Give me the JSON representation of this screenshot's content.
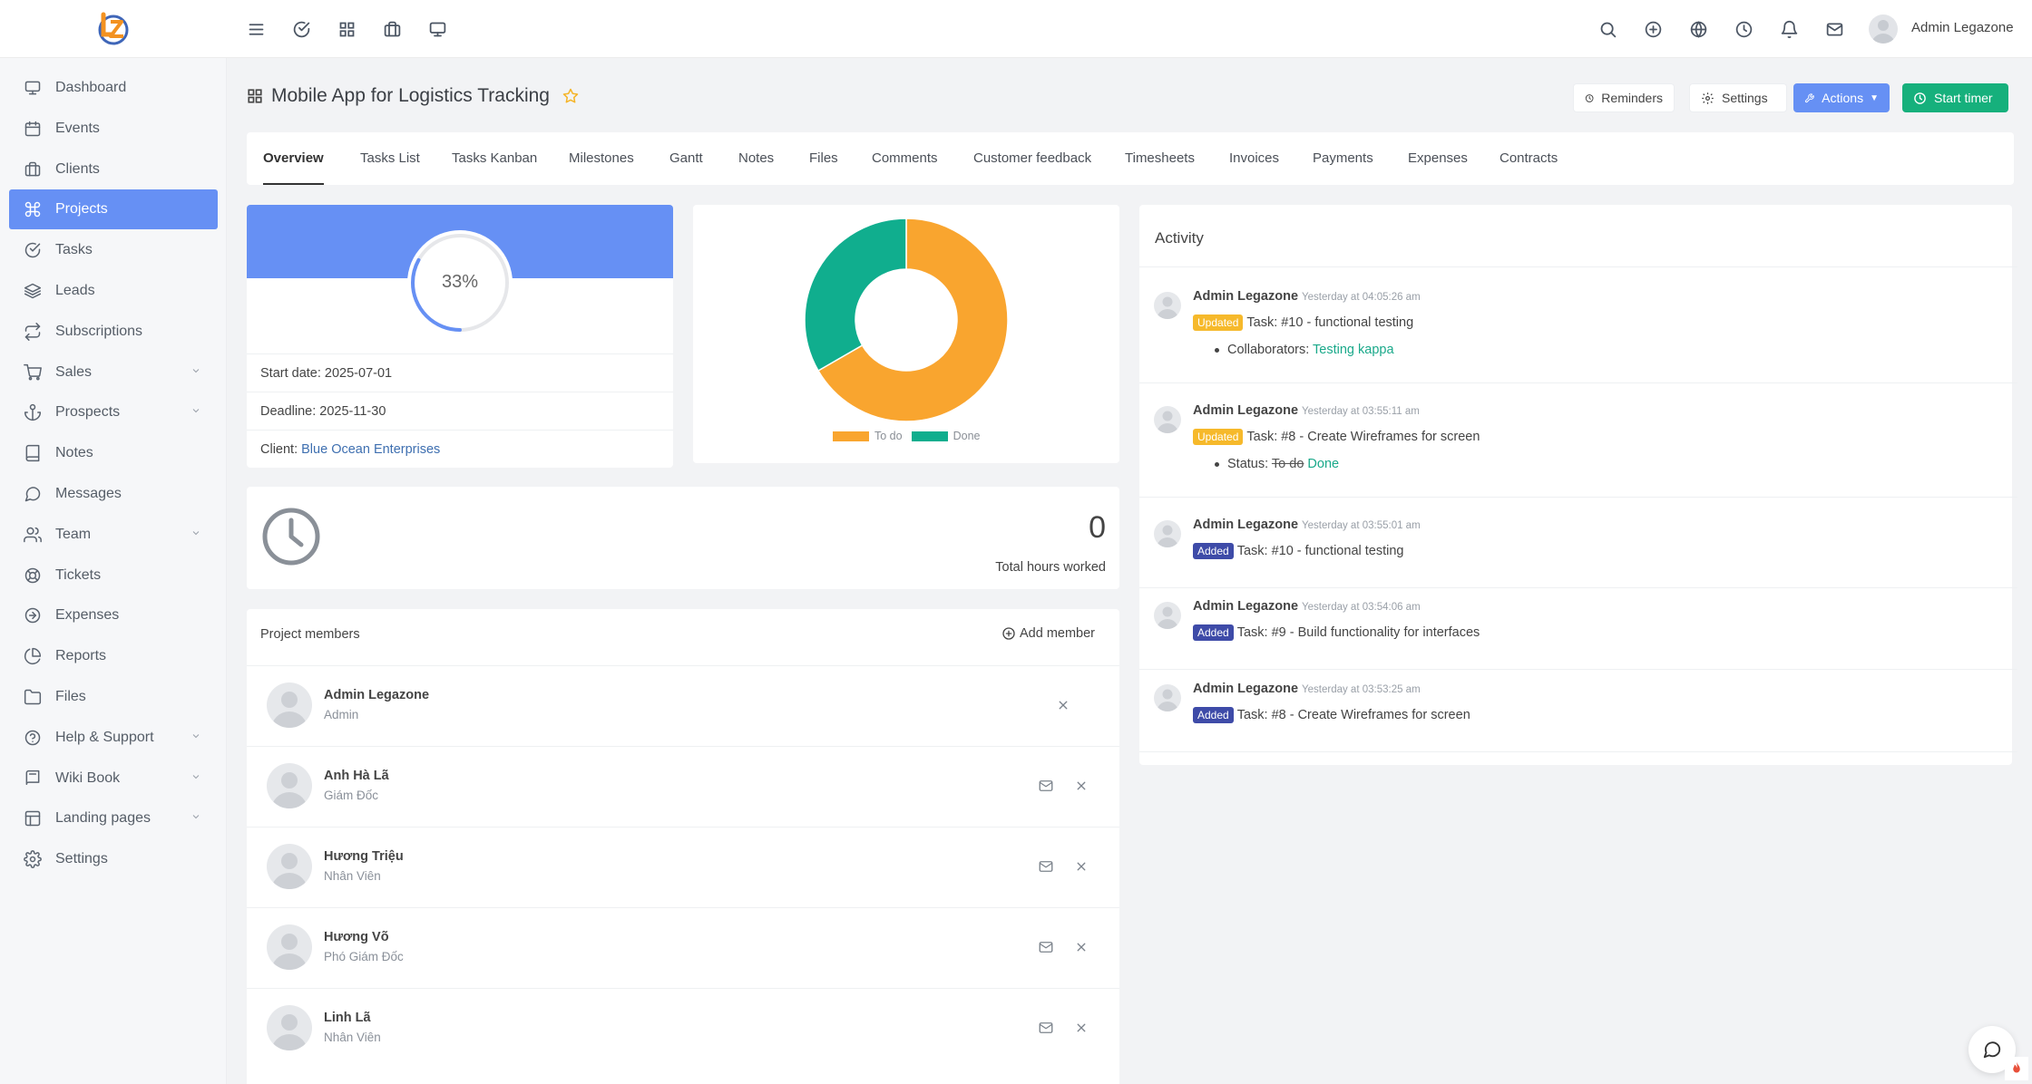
{
  "app": {
    "user_name": "Admin Legazone",
    "top_icons": [
      "menu-icon",
      "check-circle-icon",
      "apps-grid-icon",
      "briefcase-icon",
      "monitor-icon",
      "search-icon",
      "plus-circle-icon",
      "globe-icon",
      "clock-icon",
      "bell-icon",
      "mail-icon"
    ]
  },
  "sidebar": {
    "items": [
      {
        "label": "Dashboard",
        "icon": "monitor-icon"
      },
      {
        "label": "Events",
        "icon": "calendar-icon"
      },
      {
        "label": "Clients",
        "icon": "briefcase-icon"
      },
      {
        "label": "Projects",
        "icon": "command-icon",
        "active": true
      },
      {
        "label": "Tasks",
        "icon": "check-circle-icon"
      },
      {
        "label": "Leads",
        "icon": "layers-icon"
      },
      {
        "label": "Subscriptions",
        "icon": "repeat-icon"
      },
      {
        "label": "Sales",
        "icon": "cart-icon",
        "submenu": true
      },
      {
        "label": "Prospects",
        "icon": "anchor-icon",
        "submenu": true
      },
      {
        "label": "Notes",
        "icon": "book-icon"
      },
      {
        "label": "Messages",
        "icon": "message-circle-icon"
      },
      {
        "label": "Team",
        "icon": "users-icon",
        "submenu": true
      },
      {
        "label": "Tickets",
        "icon": "life-buoy-icon"
      },
      {
        "label": "Expenses",
        "icon": "arrow-right-circle-icon"
      },
      {
        "label": "Reports",
        "icon": "pie-chart-icon"
      },
      {
        "label": "Files",
        "icon": "folder-icon"
      },
      {
        "label": "Help & Support",
        "icon": "help-circle-icon",
        "submenu": true
      },
      {
        "label": "Wiki Book",
        "icon": "book-open-icon",
        "submenu": true
      },
      {
        "label": "Landing pages",
        "icon": "layout-icon",
        "submenu": true
      },
      {
        "label": "Settings",
        "icon": "gear-icon"
      }
    ]
  },
  "header": {
    "title": "Mobile App for Logistics Tracking",
    "buttons": {
      "reminders": "Reminders",
      "settings": "Settings",
      "actions": "Actions",
      "start_timer": "Start timer"
    }
  },
  "tabs": [
    "Overview",
    "Tasks List",
    "Tasks Kanban",
    "Milestones",
    "Gantt",
    "Notes",
    "Files",
    "Comments",
    "Customer feedback",
    "Timesheets",
    "Invoices",
    "Payments",
    "Expenses",
    "Contracts"
  ],
  "overview": {
    "progress": {
      "label": "33%",
      "value": 0.33
    },
    "start_date": "Start date: 2025-07-01",
    "deadline": "Deadline: 2025-11-30",
    "client_label": "Client: ",
    "client_name": "Blue Ocean Enterprises"
  },
  "task_chart": {
    "legend": [
      {
        "label": "To do",
        "color": "#f9a52f"
      },
      {
        "label": "Done",
        "color": "#10ae8e"
      }
    ],
    "values": {
      "todo": 2,
      "done": 1
    }
  },
  "hours": {
    "value": "0",
    "label": "Total hours worked"
  },
  "members": {
    "title": "Project members",
    "add_label": "Add member",
    "list": [
      {
        "name": "Admin Legazone",
        "role": "Admin",
        "can_mail": false
      },
      {
        "name": "Anh Hà Lã",
        "role": "Giám Đốc",
        "can_mail": true
      },
      {
        "name": "Hương Triệu",
        "role": "Nhân Viên",
        "can_mail": true
      },
      {
        "name": "Hương Võ",
        "role": "Phó Giám Đốc",
        "can_mail": true
      },
      {
        "name": "Linh Lã",
        "role": "Nhân Viên",
        "can_mail": true
      }
    ]
  },
  "activity": {
    "title": "Activity",
    "entries": [
      {
        "user": "Admin Legazone",
        "time": "Yesterday at 04:05:26 am",
        "badge": "Updated",
        "text": "Task: #10 - functional testing",
        "detail_label": "Collaborators: ",
        "detail_old": "",
        "detail_new": "Testing kappa"
      },
      {
        "user": "Admin Legazone",
        "time": "Yesterday at 03:55:11 am",
        "badge": "Updated",
        "text": "Task: #8 - Create Wireframes for screen",
        "detail_label": "Status: ",
        "detail_old": "To do",
        "detail_new": "Done"
      },
      {
        "user": "Admin Legazone",
        "time": "Yesterday at 03:55:01 am",
        "badge": "Added",
        "text": "Task: #10 - functional testing"
      },
      {
        "user": "Admin Legazone",
        "time": "Yesterday at 03:54:06 am",
        "badge": "Added",
        "text": "Task: #9 - Build functionality for interfaces"
      },
      {
        "user": "Admin Legazone",
        "time": "Yesterday at 03:53:25 am",
        "badge": "Added",
        "text": "Task: #8 - Create Wireframes for screen"
      }
    ]
  }
}
